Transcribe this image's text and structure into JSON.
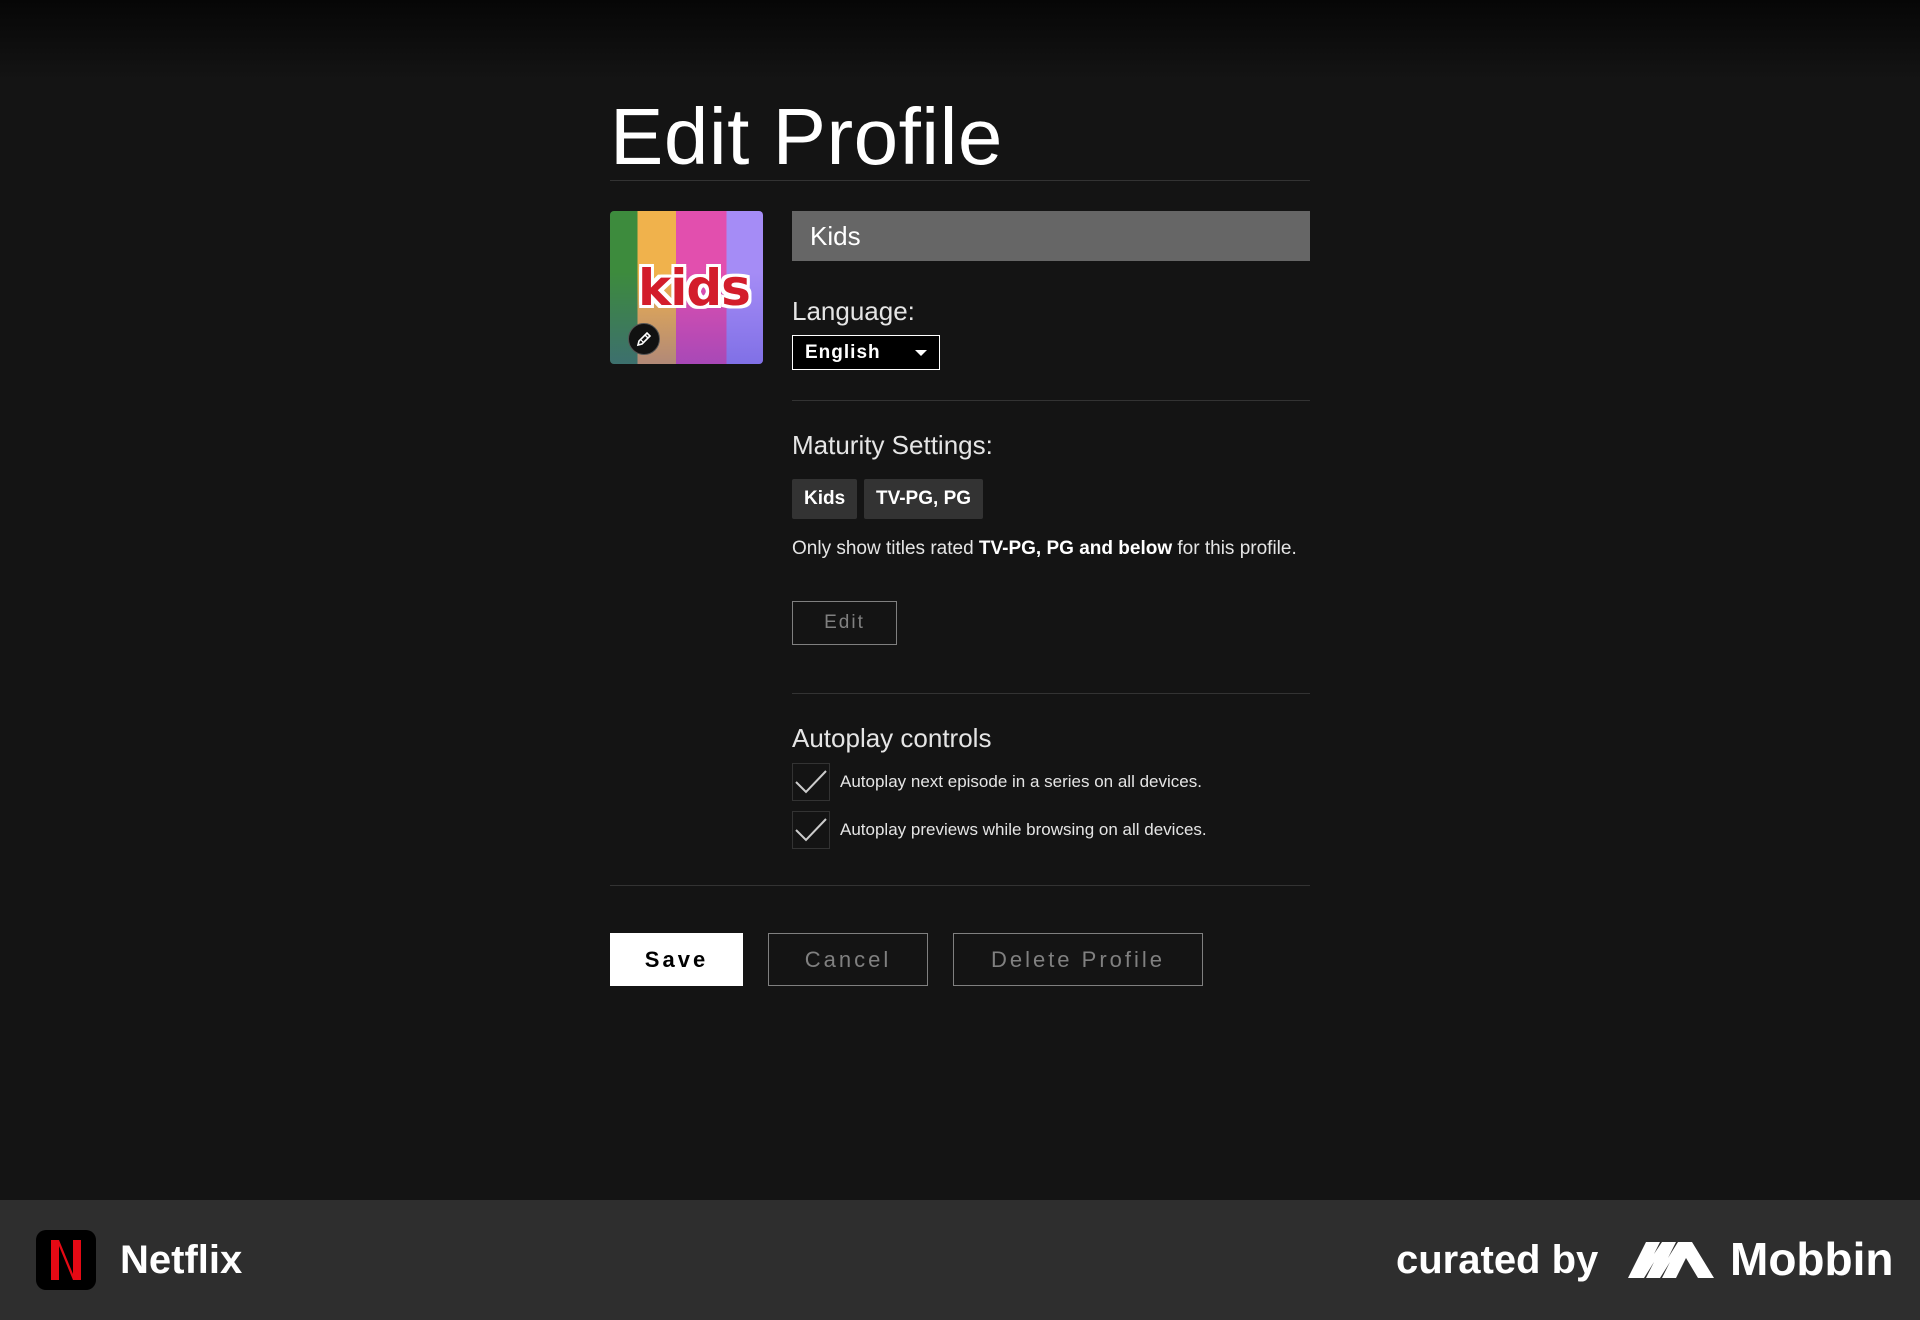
{
  "page": {
    "title": "Edit Profile"
  },
  "profile": {
    "avatar_text": "kids",
    "name_value": "Kids"
  },
  "language": {
    "label": "Language:",
    "selected": "English"
  },
  "maturity": {
    "label": "Maturity Settings:",
    "chips": [
      "Kids",
      "TV-PG, PG"
    ],
    "desc_prefix": "Only show titles rated ",
    "desc_bold": "TV-PG, PG and below",
    "desc_suffix": " for this profile.",
    "edit_label": "Edit"
  },
  "autoplay": {
    "title": "Autoplay controls",
    "options": [
      {
        "label": "Autoplay next episode in a series on all devices.",
        "checked": true
      },
      {
        "label": "Autoplay previews while browsing on all devices.",
        "checked": true
      }
    ]
  },
  "actions": {
    "save": "Save",
    "cancel": "Cancel",
    "delete": "Delete Profile"
  },
  "footer": {
    "app_name": "Netflix",
    "app_icon_letter": "N",
    "curated_by": "curated by",
    "brand": "Mobbin"
  },
  "colors": {
    "background": "#141414",
    "netflix_red": "#e50914",
    "footer_bg": "#2e2e2e"
  }
}
